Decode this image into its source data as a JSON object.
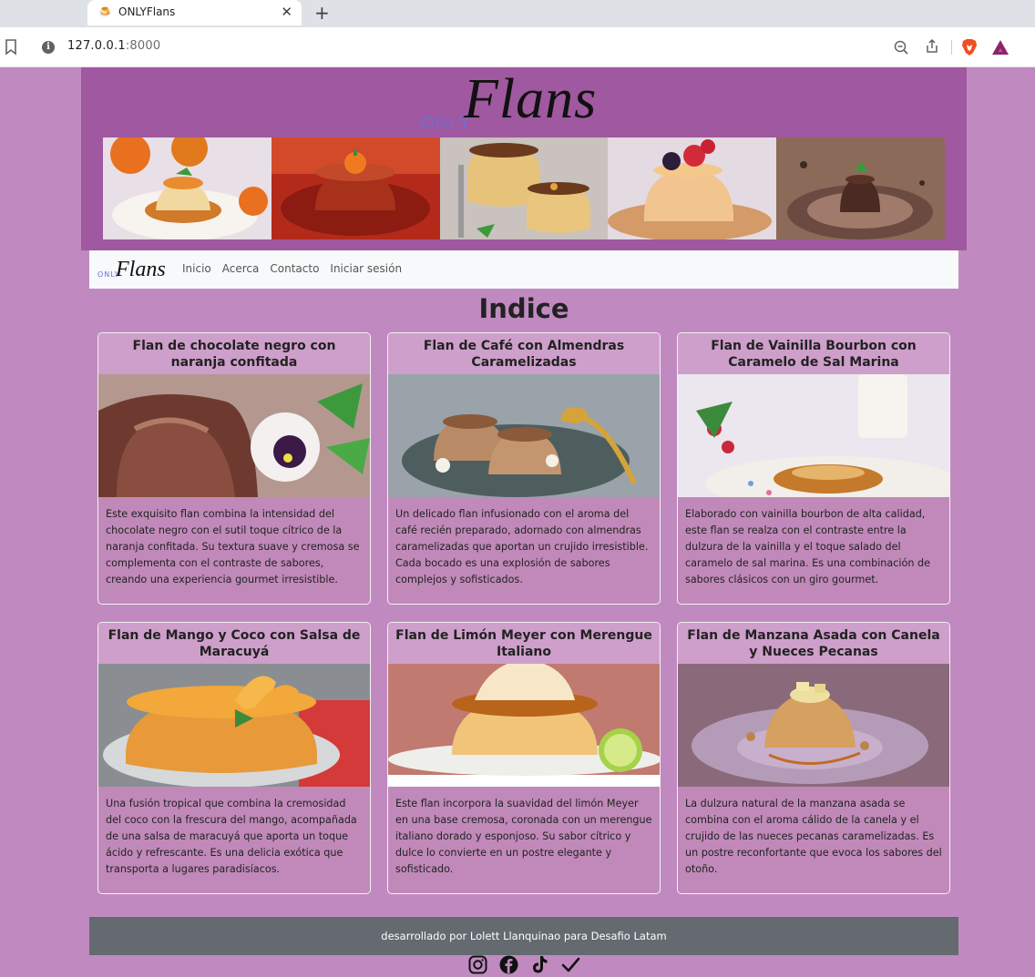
{
  "browser": {
    "tab_title": "ONLYFlans",
    "url_host": "127.0.0.1",
    "url_port": ":8000"
  },
  "brand": {
    "only": "ONLY",
    "flans": "Flans"
  },
  "nav": {
    "links": [
      "Inicio",
      "Acerca",
      "Contacto",
      "Iniciar sesión"
    ]
  },
  "page_title": "Indice",
  "cards": [
    {
      "title": "Flan de chocolate negro con naranja confitada",
      "text": "Este exquisito flan combina la intensidad del chocolate negro con el sutil toque cítrico de la naranja confitada. Su textura suave y cremosa se complementa con el contraste de sabores, creando una experiencia gourmet irresistible."
    },
    {
      "title": "Flan de Café con Almendras Caramelizadas",
      "text": "Un delicado flan infusionado con el aroma del café recién preparado, adornado con almendras caramelizadas que aportan un crujido irresistible. Cada bocado es una explosión de sabores complejos y sofisticados."
    },
    {
      "title": "Flan de Vainilla Bourbon con Caramelo de Sal Marina",
      "text": "Elaborado con vainilla bourbon de alta calidad, este flan se realza con el contraste entre la dulzura de la vainilla y el toque salado del caramelo de sal marina. Es una combinación de sabores clásicos con un giro gourmet."
    },
    {
      "title": "Flan de Mango y Coco con Salsa de Maracuyá",
      "text": "Una fusión tropical que combina la cremosidad del coco con la frescura del mango, acompañada de una salsa de maracuyá que aporta un toque ácido y refrescante. Es una delicia exótica que transporta a lugares paradisíacos."
    },
    {
      "title": "Flan de Limón Meyer con Merengue Italiano",
      "text": "Este flan incorpora la suavidad del limón Meyer en una base cremosa, coronada con un merengue italiano dorado y esponjoso. Su sabor cítrico y dulce lo convierte en un postre elegante y sofisticado."
    },
    {
      "title": "Flan de Manzana Asada con Canela y Nueces Pecanas",
      "text": "La dulzura natural de la manzana asada se combina con el aroma cálido de la canela y el crujido de las nueces pecanas caramelizadas. Es un postre reconfortante que evoca los sabores del otoño."
    }
  ],
  "footer": {
    "text": "desarrollado por Lolett Llanquinao para Desafio Latam"
  },
  "socials": [
    "instagram-icon",
    "facebook-icon",
    "tiktok-icon",
    "check-icon"
  ]
}
